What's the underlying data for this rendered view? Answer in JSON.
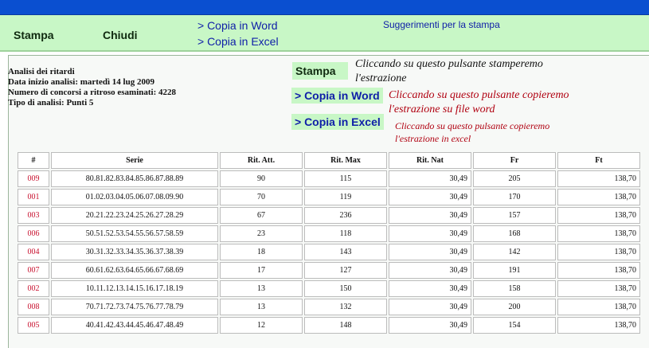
{
  "toolbar": {
    "stampa": "Stampa",
    "chiudi": "Chiudi",
    "copia_word": "> Copia in Word",
    "copia_excel": "> Copia in Excel",
    "suggerimenti": "Suggerimenti per la stampa"
  },
  "info": {
    "line1": "Analisi dei ritardi",
    "line2": "Data inizio analisi: martedì 14 lug 2009",
    "line3": "Numero di concorsi a ritroso esaminati: 4228",
    "line4": "Tipo di analisi: Punti 5"
  },
  "actions": {
    "stampa_label": "Stampa",
    "stampa_desc_1": "Cliccando su questo pulsante stamperemo",
    "stampa_desc_2": "l'estrazione",
    "word_label": "> Copia in Word",
    "word_desc_1": "Cliccando su questo pulsante copieremo",
    "word_desc_2": "l'estrazione su file word",
    "excel_label": "> Copia in Excel",
    "excel_desc_1": "Cliccando su questo pulsante copieremo",
    "excel_desc_2": "l'estrazione in excel"
  },
  "table": {
    "headers": [
      "#",
      "Serie",
      "Rit. Att.",
      "Rit. Max",
      "Rit. Nat",
      "Fr",
      "Ft"
    ],
    "rows": [
      [
        "009",
        "80.81.82.83.84.85.86.87.88.89",
        "90",
        "115",
        "30,49",
        "205",
        "138,70"
      ],
      [
        "001",
        "01.02.03.04.05.06.07.08.09.90",
        "70",
        "119",
        "30,49",
        "170",
        "138,70"
      ],
      [
        "003",
        "20.21.22.23.24.25.26.27.28.29",
        "67",
        "236",
        "30,49",
        "157",
        "138,70"
      ],
      [
        "006",
        "50.51.52.53.54.55.56.57.58.59",
        "23",
        "118",
        "30,49",
        "168",
        "138,70"
      ],
      [
        "004",
        "30.31.32.33.34.35.36.37.38.39",
        "18",
        "143",
        "30,49",
        "142",
        "138,70"
      ],
      [
        "007",
        "60.61.62.63.64.65.66.67.68.69",
        "17",
        "127",
        "30,49",
        "191",
        "138,70"
      ],
      [
        "002",
        "10.11.12.13.14.15.16.17.18.19",
        "13",
        "150",
        "30,49",
        "158",
        "138,70"
      ],
      [
        "008",
        "70.71.72.73.74.75.76.77.78.79",
        "13",
        "132",
        "30,49",
        "200",
        "138,70"
      ],
      [
        "005",
        "40.41.42.43.44.45.46.47.48.49",
        "12",
        "148",
        "30,49",
        "154",
        "138,70"
      ]
    ]
  },
  "colors": {
    "toolbar_bg": "#c8f7c6",
    "topbar_bg": "#0a4fd0",
    "link_blue": "#1020a8",
    "accent_red": "#c8102e"
  }
}
